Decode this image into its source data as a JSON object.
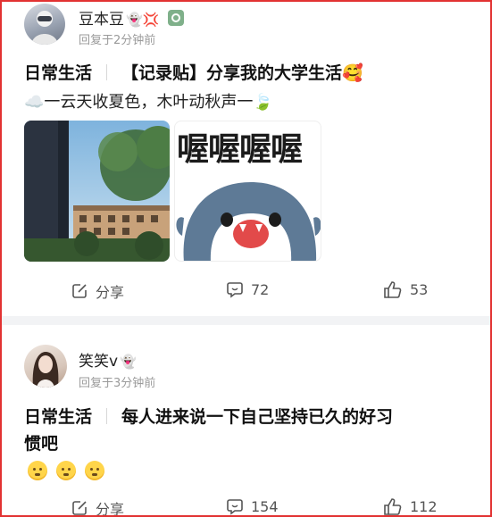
{
  "posts": [
    {
      "username": "豆本豆",
      "name_emojis": "👻💢",
      "time": "回复于2分钟前",
      "category": "日常生活",
      "title": "【记录贴】分享我的大学生活🥰",
      "subtitle": "☁️一云天收夏色，木叶动秋声一🍃",
      "image2_text": "喔喔喔喔",
      "actions": {
        "share_label": "分享",
        "comments": "72",
        "likes": "53"
      }
    },
    {
      "username": "笑笑v",
      "name_emojis": "👻",
      "time": "回复于3分钟前",
      "category": "日常生活",
      "title_line1": "每人进来说一下自己坚持已久的好习",
      "title_line2": "惯吧",
      "actions": {
        "share_label": "分享",
        "comments": "154",
        "likes": "112"
      }
    }
  ],
  "colors": {
    "accent_border": "#e23232",
    "muted_text": "#9a9a9a",
    "separator": "#f2f3f5"
  },
  "icons": [
    "share-icon",
    "comment-icon",
    "like-icon",
    "settings-badge-icon"
  ]
}
